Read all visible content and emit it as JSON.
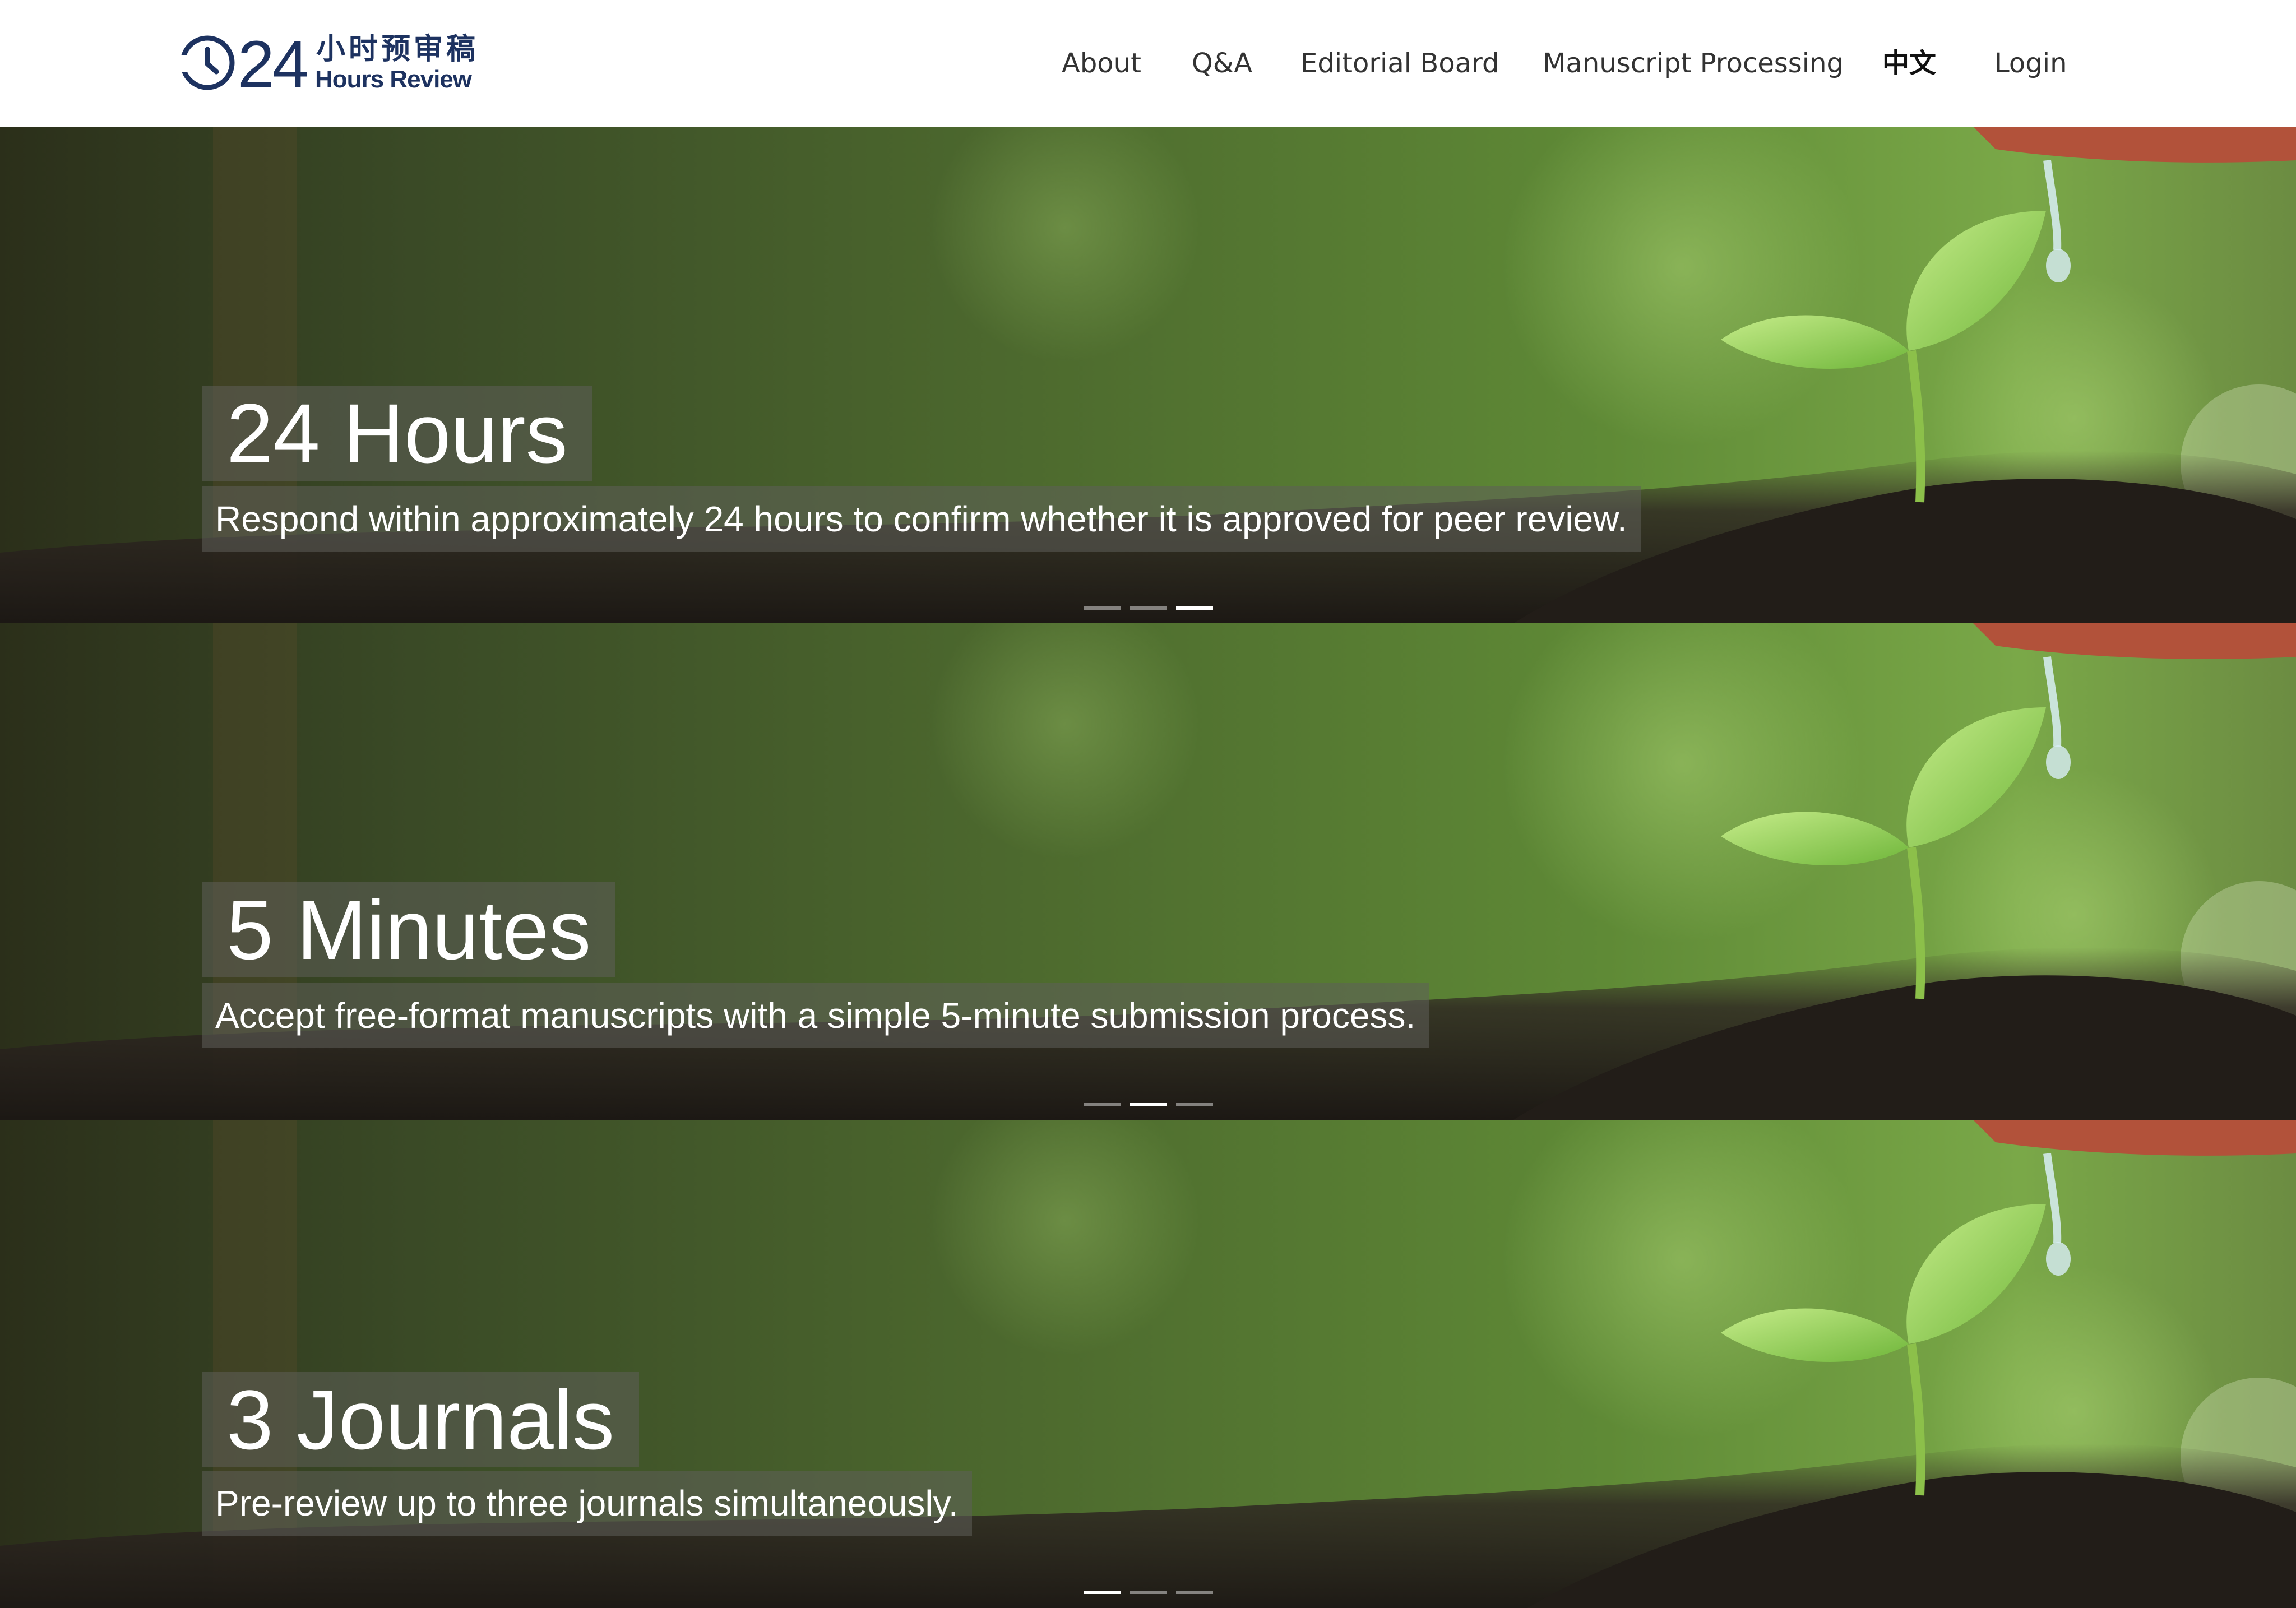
{
  "header": {
    "logo": {
      "number": "24",
      "chinese": "小时预审稿",
      "english": "Hours Review",
      "icon": "clock-icon",
      "color": "#1d3260"
    },
    "nav": [
      {
        "label": "About"
      },
      {
        "label": "Q&A"
      },
      {
        "label": "Editorial Board"
      },
      {
        "label": "Manuscript Processing"
      },
      {
        "label": "中文"
      },
      {
        "label": "Login"
      }
    ]
  },
  "slides": [
    {
      "title": "24 Hours",
      "text": "Respond within approximately 24 hours to confirm whether it is approved for peer review.",
      "active_indicator": 3
    },
    {
      "title": "5 Minutes",
      "text": "Accept free-format manuscripts with a simple 5-minute submission process.",
      "active_indicator": 2
    },
    {
      "title": "3 Journals",
      "text": "Pre-review up to three journals simultaneously.",
      "active_indicator": 1
    }
  ],
  "colors": {
    "brand": "#1d3260",
    "caption_bg": "rgba(95,95,90,0.55)",
    "nav_text": "#333333"
  }
}
